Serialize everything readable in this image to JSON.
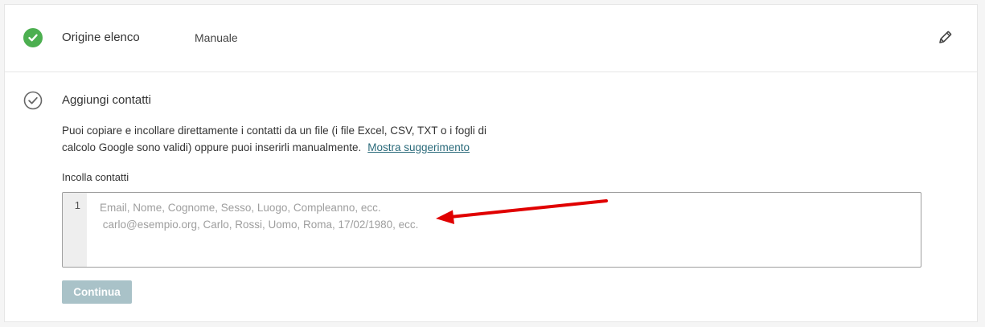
{
  "steps": {
    "origin": {
      "title": "Origine elenco",
      "value": "Manuale",
      "status_icon": "check-circle-icon",
      "edit_icon": "pencil-icon"
    },
    "add_contacts": {
      "title": "Aggiungi contatti",
      "status_icon": "check-circle-outline-icon",
      "description_line1": "Puoi copiare e incollare direttamente i contatti da un file (i file Excel, CSV, TXT o i fogli di",
      "description_line2": "calcolo Google sono validi) oppure puoi inserirli manualmente.",
      "hint_link": "Mostra suggerimento",
      "paste_label": "Incolla contatti",
      "editor": {
        "line_number": "1",
        "placeholder_line1": "Email, Nome, Cognome, Sesso, Luogo, Compleanno, ecc.",
        "placeholder_line2": " carlo@esempio.org, Carlo, Rossi, Uomo, Roma, 17/02/1980, ecc."
      },
      "continue_label": "Continua"
    }
  },
  "colors": {
    "success": "#4caf50",
    "link": "#2a6a7a",
    "button_disabled": "#a9c2c8",
    "annotation_arrow": "#e00000"
  }
}
